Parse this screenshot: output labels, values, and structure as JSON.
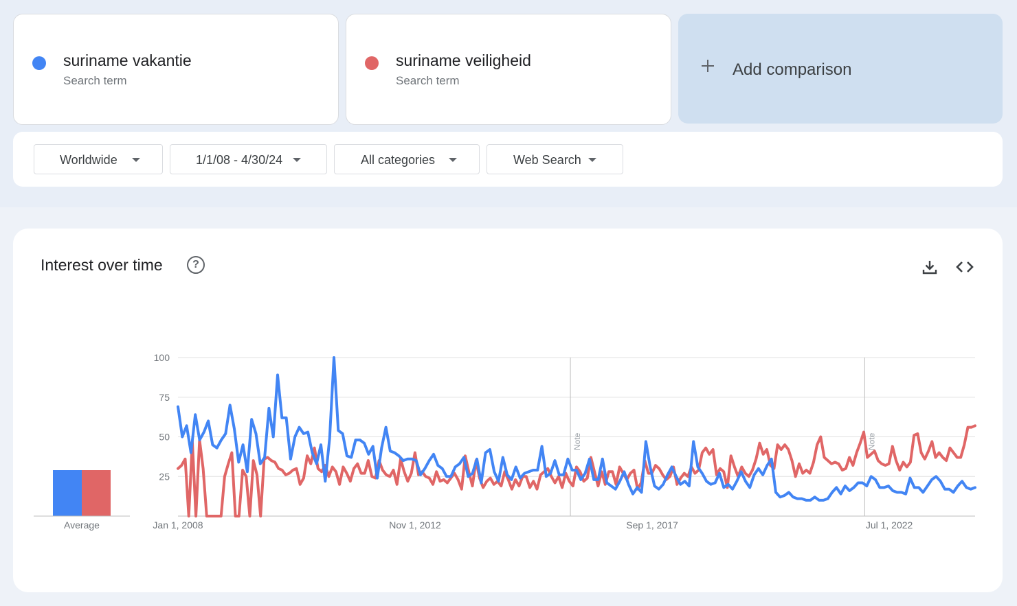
{
  "terms": [
    {
      "name": "suriname vakantie",
      "type": "Search term",
      "color": "#4285f4"
    },
    {
      "name": "suriname veiligheid",
      "type": "Search term",
      "color": "#e06666"
    }
  ],
  "add_comparison": {
    "label": "Add comparison",
    "icon": "plus-icon"
  },
  "filters": {
    "region": "Worldwide",
    "date_range": "1/1/08 - 4/30/24",
    "category": "All categories",
    "search_type": "Web Search"
  },
  "panel": {
    "title": "Interest over time",
    "help_icon": "?",
    "actions": [
      "download-icon",
      "embed-icon"
    ]
  },
  "chart_data": {
    "type": "line",
    "title": "Interest over time",
    "ylim": [
      0,
      100
    ],
    "y_ticks": [
      "100",
      "75",
      "50",
      "25"
    ],
    "x_tick_labels": [
      "Jan 1, 2008",
      "Nov 1, 2012",
      "Sep 1, 2017",
      "Jul 1, 2022"
    ],
    "x_range": [
      "2008-01",
      "2024-04"
    ],
    "notes": [
      {
        "date": "2016-01",
        "label": "Note"
      },
      {
        "date": "2022-01",
        "label": "Note"
      }
    ],
    "average": {
      "label": "Average",
      "values": [
        29,
        29
      ]
    },
    "grid": true,
    "series": [
      {
        "name": "suriname vakantie",
        "color": "#4285f4",
        "values": [
          69,
          50,
          57,
          40,
          64,
          48,
          53,
          60,
          45,
          43,
          48,
          52,
          70,
          55,
          34,
          45,
          28,
          61,
          52,
          33,
          37,
          68,
          50,
          89,
          62,
          62,
          36,
          50,
          56,
          52,
          53,
          40,
          33,
          45,
          22,
          49,
          100,
          54,
          52,
          38,
          37,
          48,
          48,
          46,
          39,
          44,
          24,
          43,
          56,
          41,
          40,
          38,
          35,
          36,
          36,
          35,
          26,
          30,
          35,
          39,
          32,
          30,
          25,
          25,
          31,
          33,
          37,
          25,
          27,
          36,
          21,
          40,
          42,
          28,
          22,
          37,
          26,
          23,
          31,
          24,
          27,
          28,
          29,
          29,
          44,
          25,
          27,
          35,
          26,
          26,
          36,
          29,
          29,
          23,
          27,
          36,
          23,
          23,
          36,
          21,
          19,
          17,
          22,
          28,
          20,
          14,
          18,
          15,
          47,
          31,
          19,
          17,
          20,
          26,
          31,
          25,
          20,
          22,
          19,
          47,
          31,
          27,
          22,
          20,
          21,
          27,
          18,
          20,
          17,
          22,
          28,
          22,
          18,
          26,
          30,
          26,
          32,
          36,
          15,
          12,
          13,
          15,
          12,
          11,
          11,
          10,
          10,
          12,
          10,
          10,
          11,
          15,
          18,
          14,
          19,
          16,
          18,
          21,
          21,
          19,
          25,
          23,
          18,
          18,
          19,
          16,
          15,
          15,
          14,
          24,
          18,
          18,
          15,
          19,
          23,
          25,
          22,
          17,
          17,
          15,
          19,
          22,
          18,
          17,
          18
        ],
        "note": "approximate monthly values read from the chart"
      },
      {
        "name": "suriname veiligheid",
        "color": "#e06666",
        "values": [
          30,
          32,
          36,
          0,
          47,
          0,
          48,
          30,
          0,
          0,
          0,
          0,
          0,
          25,
          33,
          40,
          0,
          0,
          29,
          25,
          0,
          35,
          26,
          0,
          36,
          37,
          35,
          34,
          30,
          29,
          26,
          27,
          29,
          30,
          20,
          24,
          38,
          33,
          43,
          30,
          28,
          32,
          25,
          31,
          28,
          20,
          31,
          27,
          22,
          30,
          33,
          27,
          27,
          35,
          25,
          24,
          35,
          29,
          26,
          25,
          29,
          20,
          36,
          28,
          22,
          27,
          40,
          26,
          28,
          25,
          24,
          20,
          28,
          22,
          23,
          21,
          24,
          27,
          23,
          17,
          38,
          28,
          19,
          35,
          24,
          18,
          22,
          24,
          20,
          22,
          19,
          28,
          23,
          17,
          23,
          19,
          25,
          25,
          18,
          22,
          17,
          26,
          28,
          30,
          25,
          21,
          25,
          18,
          27,
          22,
          19,
          31,
          28,
          22,
          24,
          37,
          28,
          19,
          28,
          20,
          28,
          28,
          20,
          31,
          27,
          23,
          27,
          29,
          17,
          21,
          35,
          27,
          27,
          32,
          30,
          26,
          23,
          25,
          31,
          20,
          24,
          27,
          25,
          31,
          27,
          29,
          40,
          43,
          39,
          42,
          26,
          30,
          28,
          18,
          38,
          31,
          25,
          31,
          27,
          25,
          29,
          36,
          46,
          39,
          42,
          32,
          30,
          45,
          42,
          45,
          42,
          35,
          25,
          33,
          27,
          29,
          27,
          34,
          45,
          50,
          37,
          35,
          33,
          34,
          33,
          29,
          30,
          37,
          32,
          40,
          46,
          53,
          37,
          39,
          41,
          35,
          33,
          32,
          33,
          44,
          35,
          29,
          34,
          31,
          34,
          51,
          52,
          40,
          36,
          41,
          47,
          37,
          40,
          37,
          35,
          43,
          40,
          37,
          37,
          45,
          56,
          56,
          57
        ],
        "note": "approximate monthly values read from the chart"
      }
    ]
  }
}
